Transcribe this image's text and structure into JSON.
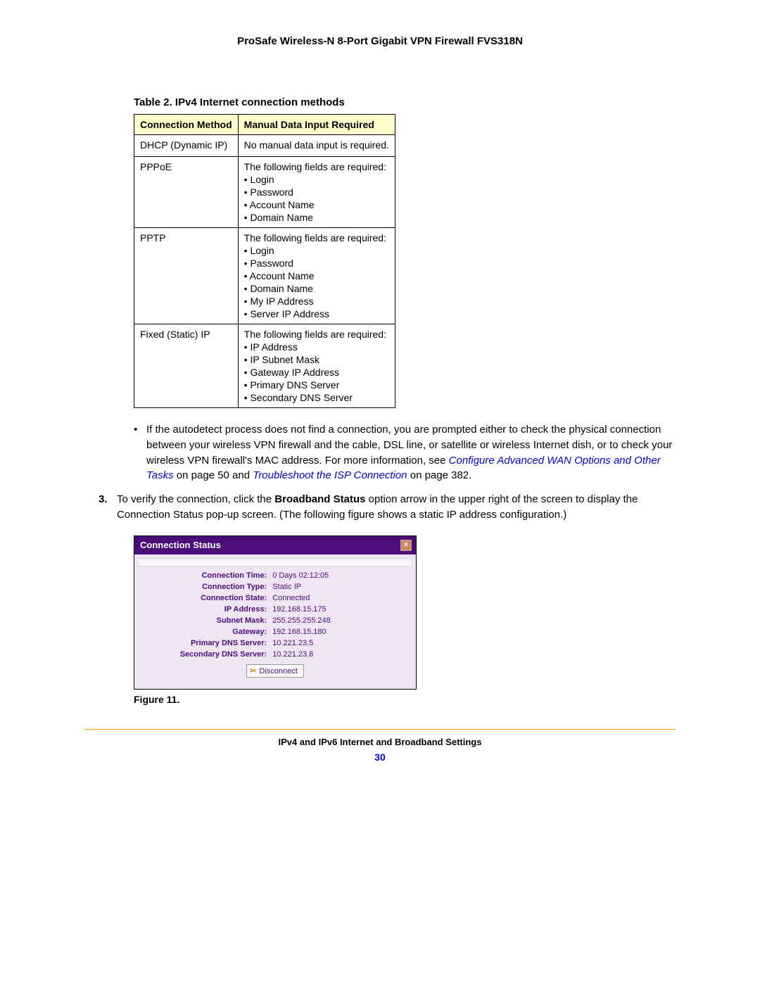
{
  "header": {
    "title": "ProSafe Wireless-N 8-Port Gigabit VPN Firewall FVS318N"
  },
  "table": {
    "caption": "Table 2.  IPv4 Internet connection methods",
    "headers": {
      "col1": "Connection Method",
      "col2": "Manual Data Input Required"
    },
    "rows": [
      {
        "method": "DHCP (Dynamic IP)",
        "intro": "No manual data input is required.",
        "items": []
      },
      {
        "method": "PPPoE",
        "intro": "The following fields are required:",
        "items": [
          "Login",
          "Password",
          "Account  Name",
          "Domain  Name"
        ]
      },
      {
        "method": "PPTP",
        "intro": "The following fields are required:",
        "items": [
          "Login",
          "Password",
          "Account  Name",
          "Domain  Name",
          "My  IP  Address",
          "Server  IP  Address"
        ]
      },
      {
        "method": "Fixed (Static) IP",
        "intro": "The following fields are required:",
        "items": [
          "IP  Address",
          "IP  Subnet Mask",
          "Gateway  IP  Address",
          "Primary  DNS  Server",
          "Secondary  DNS  Server"
        ]
      }
    ]
  },
  "para": {
    "autodetect_a": "If the autodetect process does not find a connection, you are prompted either to check the physical connection between your wireless VPN firewall and the cable, DSL line, or satellite or wireless Internet dish, or to check your wireless VPN firewall's MAC address. For more information, see ",
    "link1": "Configure Advanced WAN Options and Other Tasks",
    "autodetect_b": " on page 50 and ",
    "link2": "Troubleshoot the ISP Connection",
    "autodetect_c": " on page 382."
  },
  "step3": {
    "num": "3.",
    "a": "To verify the connection, click the ",
    "bold": "Broadband Status",
    "b": " option arrow in the upper right of the screen to display the Connection Status pop-up screen. (The following figure shows a static IP address configuration.)"
  },
  "popup": {
    "title": "Connection Status",
    "rows": [
      {
        "label": "Connection Time:",
        "value": "0 Days 02:12:05"
      },
      {
        "label": "Connection Type:",
        "value": "Static IP"
      },
      {
        "label": "Connection State:",
        "value": "Connected"
      },
      {
        "label": "IP Address:",
        "value": "192.168.15.175"
      },
      {
        "label": "Subnet Mask:",
        "value": "255.255.255.248"
      },
      {
        "label": "Gateway:",
        "value": "192.168.15.180"
      },
      {
        "label": "Primary DNS Server:",
        "value": "10.221.23.5"
      },
      {
        "label": "Secondary DNS Server:",
        "value": "10.221.23.8"
      }
    ],
    "button": "Disconnect"
  },
  "figure_caption": "Figure 11.",
  "footer": {
    "section": "IPv4 and IPv6 Internet and Broadband Settings",
    "page": "30"
  }
}
